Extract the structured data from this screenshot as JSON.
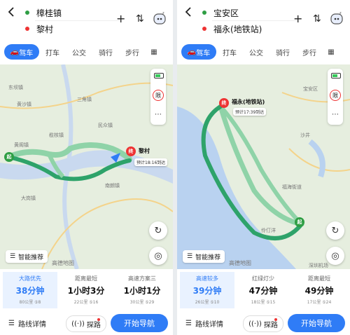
{
  "left": {
    "origin": "樟桂镇",
    "destination": "黎村",
    "modes": [
      "驾车",
      "打车",
      "公交",
      "骑行",
      "步行"
    ],
    "map": {
      "labels": [
        "东坝镇",
        "三角镇",
        "黄沙镇",
        "民众镇",
        "榄核镇",
        "黄阁镇",
        "南朗镇",
        "大岗镇"
      ],
      "dest_name": "黎村",
      "dest_eta": "预计18:16到达",
      "end_pin": "终",
      "start_pin": "起",
      "logo": "高德地图"
    },
    "smart_label": "智能推荐",
    "routes": [
      {
        "label": "大路优先",
        "time": "38分钟",
        "sub": "80公里 ⑤8"
      },
      {
        "label": "距离最短",
        "time": "1小时3分",
        "sub": "22公里 ⑤16"
      },
      {
        "label": "高速方案三",
        "time": "1小时1分",
        "sub": "30公里 ⑤29"
      }
    ],
    "detail_label": "路线详情",
    "explore_label": "探路",
    "start_label": "开始导航"
  },
  "right": {
    "origin": "宝安区",
    "destination": "福永(地铁站)",
    "modes": [
      "驾车",
      "打车",
      "公交",
      "骑行",
      "步行"
    ],
    "map": {
      "labels": [
        "宝安区",
        "沙井",
        "福海街道",
        "伶仃洋",
        "深圳机场"
      ],
      "dest_name": "福永(地铁站)",
      "dest_eta": "预计17:39到达",
      "end_pin": "终",
      "start_pin": "起",
      "logo": "高德地图"
    },
    "smart_label": "智能推荐",
    "routes": [
      {
        "label": "高速较多",
        "time": "39分钟",
        "sub": "26公里 ⑤10"
      },
      {
        "label": "红绿灯少",
        "time": "47分钟",
        "sub": "18公里 ⑤15"
      },
      {
        "label": "距离最短",
        "time": "49分钟",
        "sub": "17公里 ⑤24"
      }
    ],
    "detail_label": "路线详情",
    "explore_label": "探路",
    "start_label": "开始导航"
  },
  "icons": {
    "back": "back-arrow-icon",
    "add": "plus-icon",
    "swap": "swap-icon",
    "assistant": "assistant-bot-icon"
  }
}
